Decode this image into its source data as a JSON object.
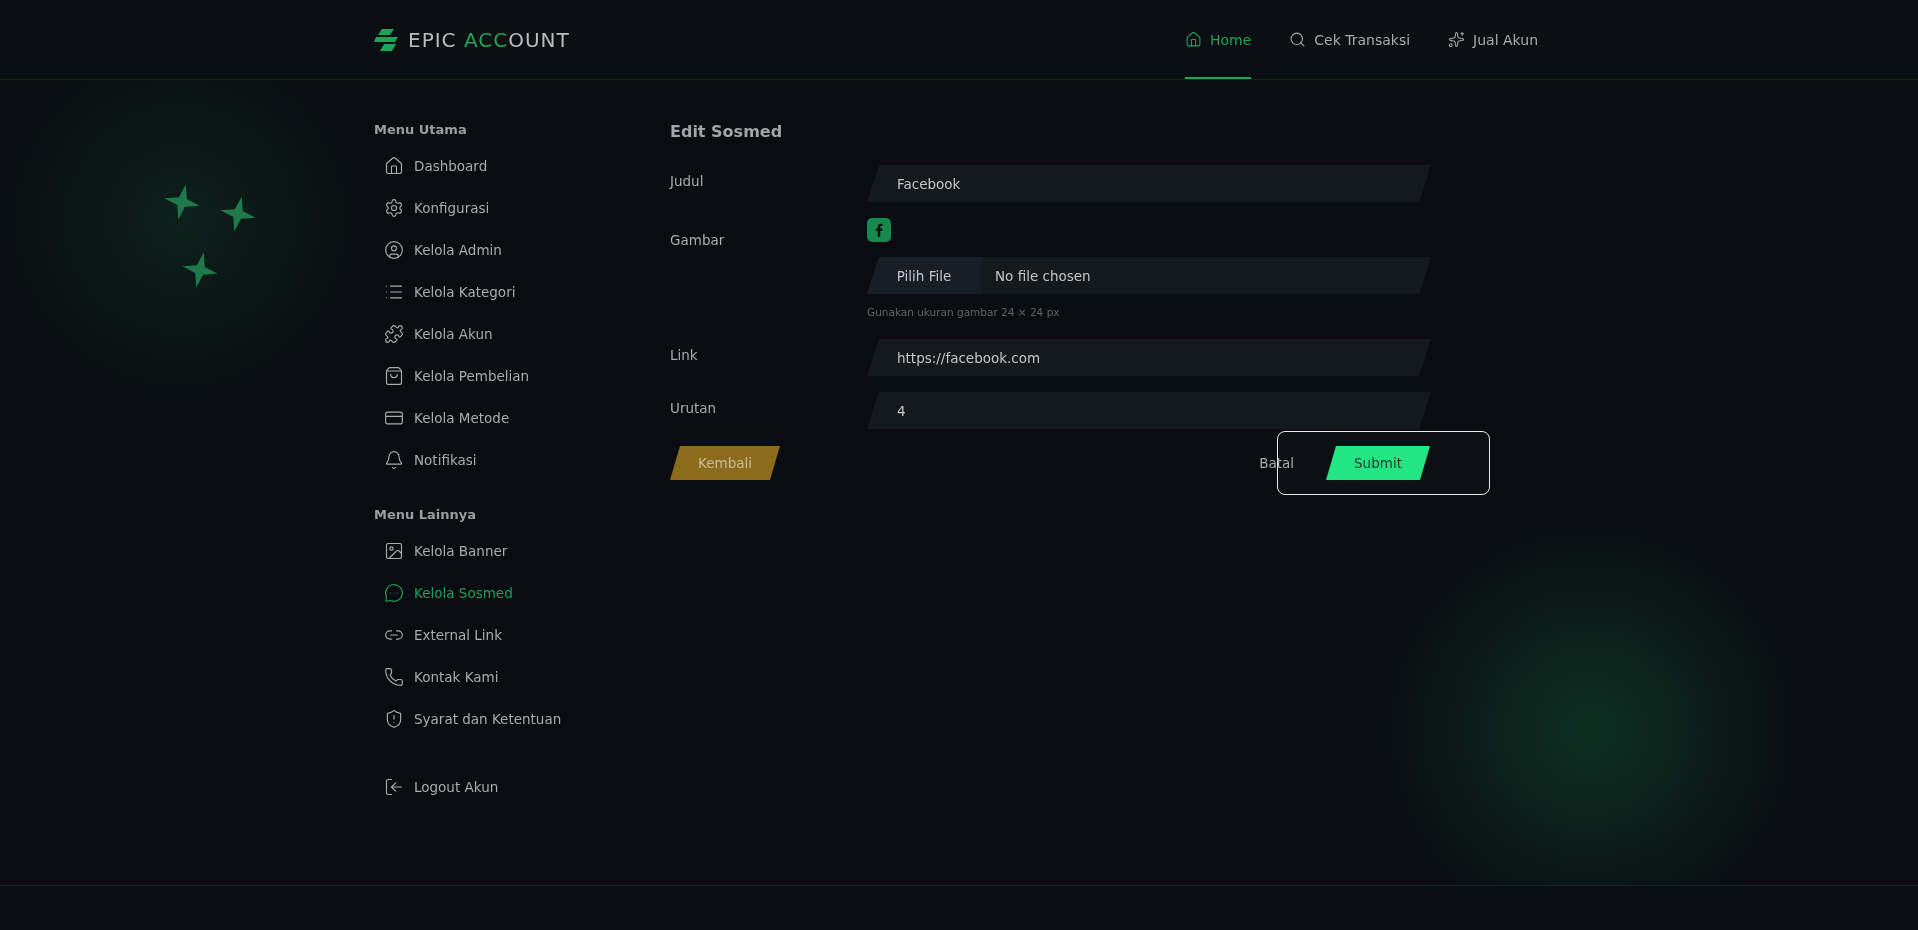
{
  "logo": {
    "segments": [
      {
        "text": "EPIC ",
        "accent": false
      },
      {
        "text": "ACC",
        "accent": true
      },
      {
        "text": "OUNT",
        "accent": false
      }
    ]
  },
  "nav": [
    {
      "label": "Home",
      "selected": true
    },
    {
      "label": "Cek Transaksi",
      "selected": false
    },
    {
      "label": "Jual Akun",
      "selected": false
    }
  ],
  "sidebar": {
    "sections": [
      {
        "title": "Menu Utama",
        "items": [
          {
            "label": "Dashboard",
            "selected": false
          },
          {
            "label": "Konfigurasi",
            "selected": false
          },
          {
            "label": "Kelola Admin",
            "selected": false
          },
          {
            "label": "Kelola Kategori",
            "selected": false
          },
          {
            "label": "Kelola Akun",
            "selected": false
          },
          {
            "label": "Kelola Pembelian",
            "selected": false
          },
          {
            "label": "Kelola Metode",
            "selected": false
          },
          {
            "label": "Notifikasi",
            "selected": false
          }
        ]
      },
      {
        "title": "Menu Lainnya",
        "items": [
          {
            "label": "Kelola Banner",
            "selected": false
          },
          {
            "label": "Kelola Sosmed",
            "selected": true
          },
          {
            "label": "External Link",
            "selected": false
          },
          {
            "label": "Kontak Kami",
            "selected": false
          },
          {
            "label": "Syarat dan Ketentuan",
            "selected": false
          }
        ]
      }
    ],
    "logout": {
      "label": "Logout Akun"
    }
  },
  "form": {
    "title": "Edit Sosmed",
    "fields": [
      {
        "kind": "text",
        "label": "Judul",
        "value": "Facebook"
      },
      {
        "kind": "file",
        "label": "Gambar",
        "button": "Pilih File",
        "status": "No file chosen",
        "hint": "Gunakan ukuran gambar 24 × 24 px"
      },
      {
        "kind": "text",
        "label": "Link",
        "value": "https://facebook.com"
      },
      {
        "kind": "text",
        "label": "Urutan",
        "value": "4"
      }
    ],
    "back_button": "Kembali",
    "cancel_button": "Batal",
    "submit_button": "Submit",
    "actions_focused": true
  }
}
